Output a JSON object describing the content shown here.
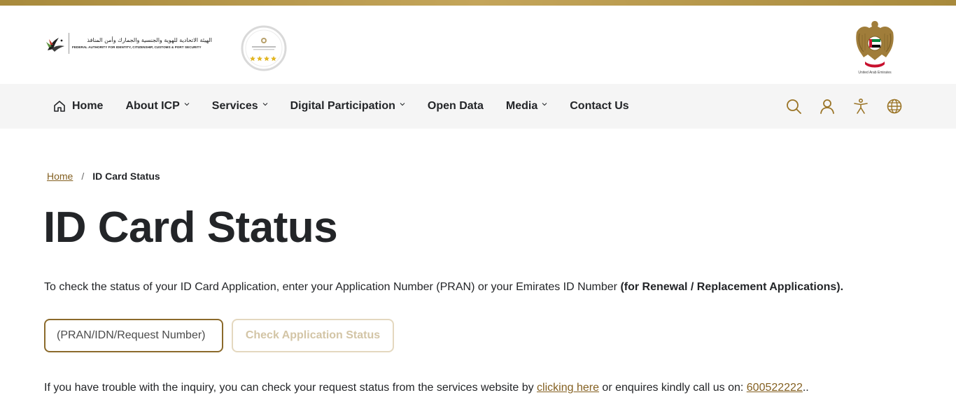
{
  "header": {
    "logo_ar": "الهيئة الاتحادية للهوية والجنسية والجمارك وأمن المنافذ",
    "logo_en": "FEDERAL AUTHORITY FOR IDENTITY, CITIZENSHIP, CUSTOMS & PORT SECURITY",
    "emblem_caption": "United Arab Emirates"
  },
  "nav": {
    "items": [
      {
        "label": "Home",
        "icon": "home-icon",
        "dropdown": false
      },
      {
        "label": "About ICP",
        "dropdown": true
      },
      {
        "label": "Services",
        "dropdown": true
      },
      {
        "label": "Digital Participation",
        "dropdown": true
      },
      {
        "label": "Open Data",
        "dropdown": false
      },
      {
        "label": "Media",
        "dropdown": true
      },
      {
        "label": "Contact Us",
        "dropdown": false
      }
    ],
    "icons": [
      "search-icon",
      "user-icon",
      "accessibility-icon",
      "globe-icon"
    ]
  },
  "breadcrumb": {
    "home": "Home",
    "separator": "/",
    "current": "ID Card Status"
  },
  "page": {
    "title": "ID Card Status",
    "intro": "To check the status of your ID Card Application, enter your Application Number (PRAN) or your Emirates ID Number ",
    "intro_bold": "(for Renewal / Replacement Applications).",
    "input_placeholder": "(PRAN/IDN/Request Number)",
    "input_value": "",
    "button_label": "Check Application Status",
    "help_prefix": "If you have trouble with the inquiry, you can check your request status from the services website by ",
    "help_link": "clicking here",
    "help_middle": " or enquires kindly call us on: ",
    "help_phone": "600522222",
    "help_suffix": ".."
  },
  "colors": {
    "accent_gold": "#846021",
    "input_border": "#8b6a2b",
    "button_disabled_border": "#e4d8bf",
    "button_disabled_text": "#d3c5a6",
    "nav_bg": "#f5f5f5",
    "top_bar": "#b8994a",
    "icon_gold": "#9a7426"
  }
}
